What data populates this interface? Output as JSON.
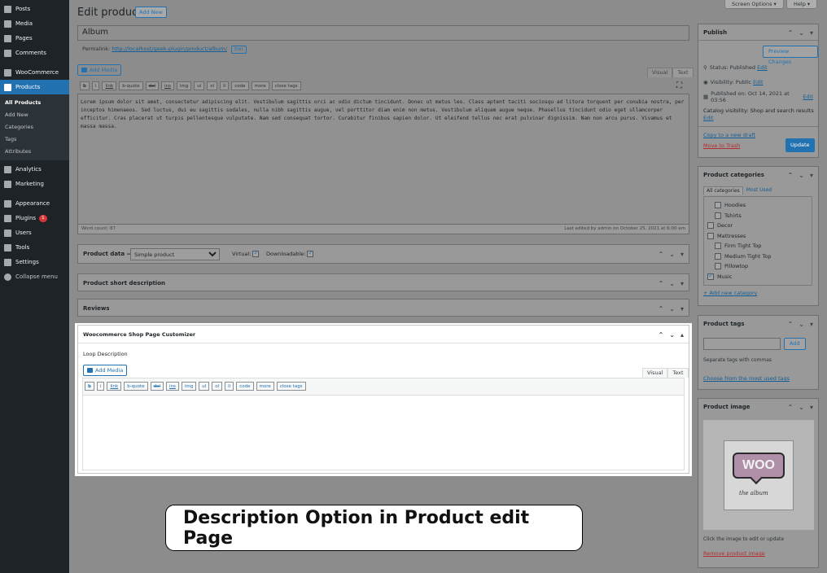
{
  "sidebar": {
    "items": [
      {
        "label": "Posts",
        "icon": "pin-icon"
      },
      {
        "label": "Media",
        "icon": "media-icon"
      },
      {
        "label": "Pages",
        "icon": "pages-icon"
      },
      {
        "label": "Comments",
        "icon": "comments-icon"
      },
      {
        "label": "WooCommerce",
        "icon": "woocommerce-icon"
      },
      {
        "label": "Products",
        "icon": "products-icon"
      }
    ],
    "submenu": [
      "All Products",
      "Add New",
      "Categories",
      "Tags",
      "Attributes"
    ],
    "items2": [
      {
        "label": "Analytics",
        "icon": "analytics-icon"
      },
      {
        "label": "Marketing",
        "icon": "marketing-icon"
      },
      {
        "label": "Appearance",
        "icon": "appearance-icon"
      },
      {
        "label": "Plugins",
        "icon": "plugins-icon",
        "badge": "1"
      },
      {
        "label": "Users",
        "icon": "users-icon"
      },
      {
        "label": "Tools",
        "icon": "tools-icon"
      },
      {
        "label": "Settings",
        "icon": "settings-icon"
      },
      {
        "label": "Collapse menu",
        "icon": "collapse-icon"
      }
    ]
  },
  "topbar": {
    "screen_options": "Screen Options ▾",
    "help": "Help ▾"
  },
  "header": {
    "title": "Edit product",
    "add_new": "Add New"
  },
  "post": {
    "title": "Album",
    "permalink_label": "Permalink:",
    "permalink_url": "http://localhost/geek-plugin/product/album/",
    "edit": "Edit"
  },
  "editor": {
    "add_media": "Add Media",
    "tab_visual": "Visual",
    "tab_text": "Text",
    "quicktags": [
      "b",
      "i",
      "link",
      "b-quote",
      "del",
      "ins",
      "img",
      "ul",
      "ol",
      "li",
      "code",
      "more",
      "close tags"
    ],
    "content": "Lorem ipsum dolor sit amet, consectetur adipiscing elit. Vestibulum sagittis orci ac odio dictum tincidunt. Donec ut metus leo. Class aptent taciti sociosqu ad litora torquent per conubia nostra, per inceptos himenaeos. Sed luctus, dui eu sagittis sodales, nulla nibh sagittis augue, vel porttitor diam enim non metus. Vestibulum aliquam augue neque. Phasellus tincidunt odio eget ullamcorper efficitur. Cras placerat ut turpis pellentesque vulputate. Nam sed consequat tortor. Curabitur finibus sapien dolor. Ut eleifend tellus nec erat pulvinar dignissim. Nam non arcu purus. Vivamus et massa massa.",
    "word_count": "Word count: 87",
    "last_edited": "Last edited by admin on October 25, 2021 at 6:00 am"
  },
  "product_data": {
    "label": "Product data —",
    "type": "Simple product",
    "virtual": "Virtual:",
    "downloadable": "Downloadable:"
  },
  "boxes": {
    "short_desc": "Product short description",
    "reviews": "Reviews",
    "customizer": "Woocommerce Shop Page Customizer",
    "loop_desc": "Loop Description"
  },
  "publish": {
    "title": "Publish",
    "preview": "Preview Changes",
    "status": "Status: Published",
    "visibility": "Visibility: Public",
    "published_on": "Published on: Oct 14, 2021 at 03:56",
    "catalog": "Catalog visibility: Shop and search results",
    "edit": "Edit",
    "copy_draft": "Copy to a new draft",
    "trash": "Move to Trash",
    "update": "Update"
  },
  "categories": {
    "title": "Product categories",
    "tab_all": "All categories",
    "tab_most": "Most Used",
    "items": [
      {
        "label": "Hoodies",
        "checked": false,
        "indent": true
      },
      {
        "label": "Tshirts",
        "checked": false,
        "indent": true
      },
      {
        "label": "Decor",
        "checked": false,
        "indent": false
      },
      {
        "label": "Mattresses",
        "checked": false,
        "indent": false
      },
      {
        "label": "Firm Tight Top",
        "checked": false,
        "indent": true
      },
      {
        "label": "Medium Tight Top",
        "checked": false,
        "indent": true
      },
      {
        "label": "Pillowtop",
        "checked": false,
        "indent": true
      },
      {
        "label": "Music",
        "checked": true,
        "indent": false
      }
    ],
    "add_new": "+ Add new category"
  },
  "tags": {
    "title": "Product tags",
    "add": "Add",
    "hint": "Separate tags with commas",
    "choose": "Choose from the most used tags"
  },
  "image": {
    "title": "Product image",
    "logo_text": "WOO",
    "logo_sub": "the album",
    "hint": "Click the image to edit or update",
    "remove": "Remove product image"
  },
  "caption": "Description Option in Product edit Page"
}
